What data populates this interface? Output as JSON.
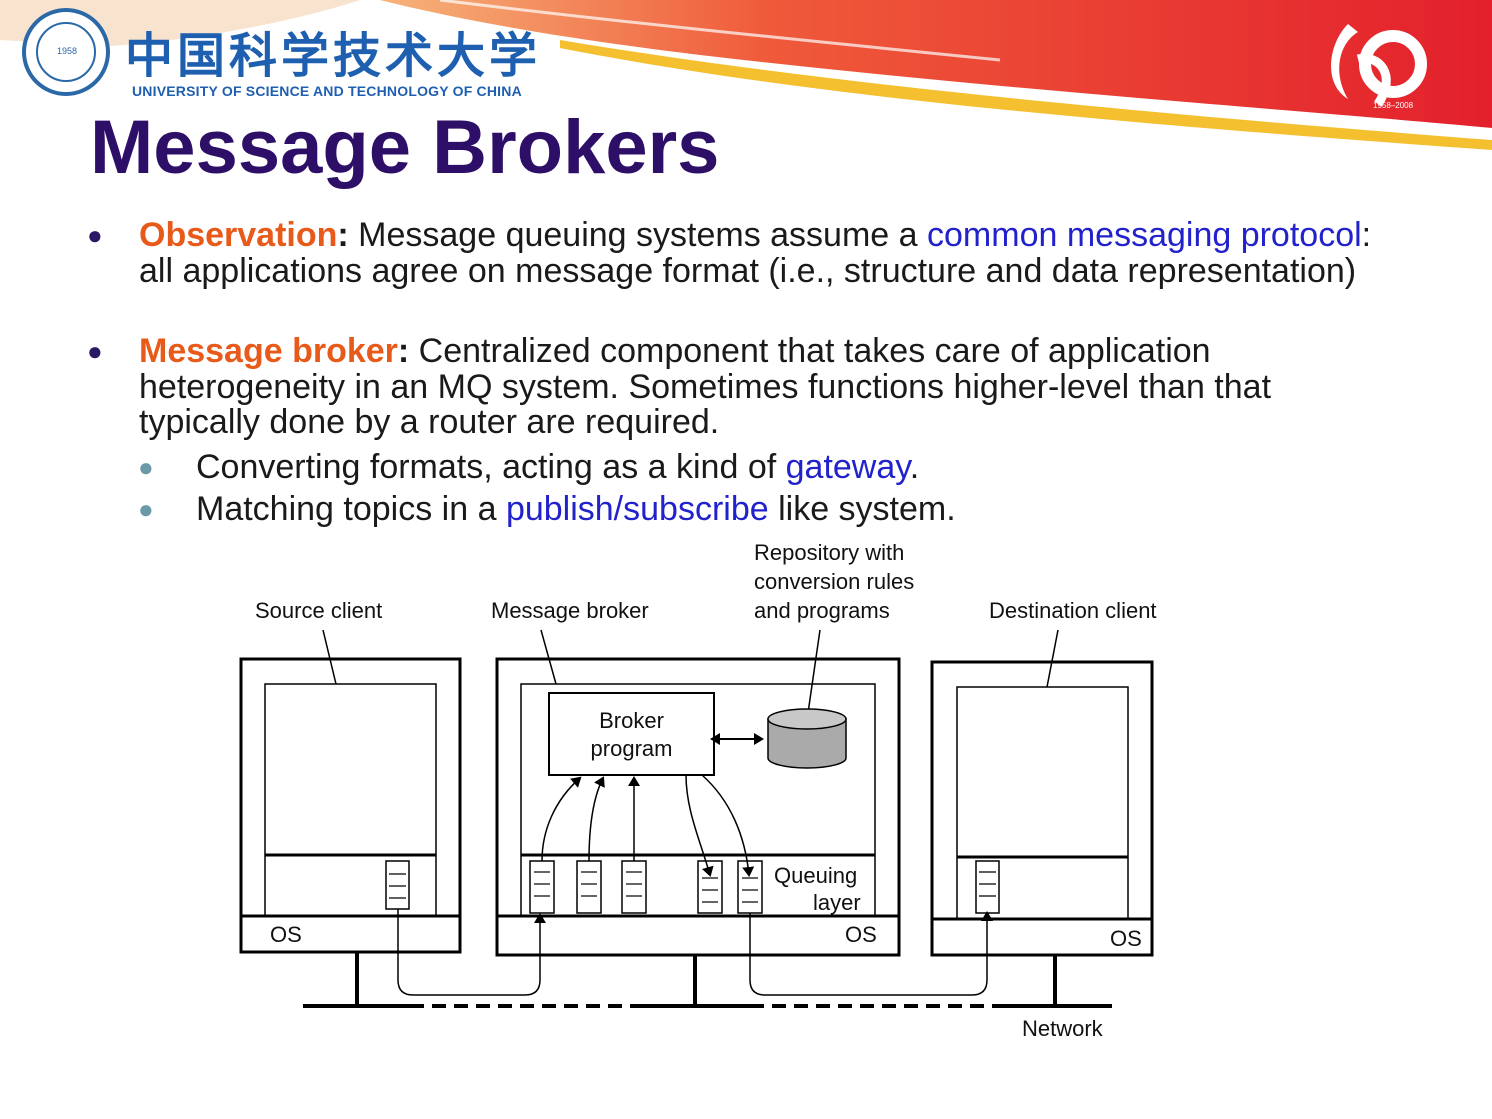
{
  "header": {
    "university_cn": "中国科学技术大学",
    "university_en": "UNIVERSITY OF SCIENCE AND TECHNOLOGY OF CHINA",
    "seal_year": "1958",
    "anniversary_text": "1958–2008"
  },
  "slide": {
    "title": "Message Brokers",
    "bullets": [
      {
        "term": "Observation",
        "sep": ":",
        "text1": " Message queuing systems assume a ",
        "link": "common messaging protocol",
        "text2": ": all applications agree on message format (i.e., structure and data representation)"
      },
      {
        "term": "Message broker",
        "sep": ":",
        "text": " Centralized component that takes care of application heterogeneity in an MQ system. Sometimes functions higher-level than that typically done by a router are required."
      }
    ],
    "subbullets": [
      {
        "text1": "Converting formats, acting as a kind of ",
        "link": "gateway",
        "text2": "."
      },
      {
        "text1": "Matching topics in a ",
        "link": "publish/subscribe",
        "text2": " like system."
      }
    ]
  },
  "diagram": {
    "labels": {
      "source_client": "Source client",
      "message_broker": "Message broker",
      "repository": [
        "Repository with",
        "conversion rules",
        "and programs"
      ],
      "destination_client": "Destination client",
      "broker_program": [
        "Broker",
        "program"
      ],
      "queuing_layer": [
        "Queuing",
        "layer"
      ],
      "os": "OS",
      "network": "Network"
    }
  },
  "colors": {
    "title": "#2e0f68",
    "term": "#e85a1a",
    "link": "#2222cc",
    "banner_red": "#e8262a",
    "university_blue": "#1f5fb0"
  }
}
